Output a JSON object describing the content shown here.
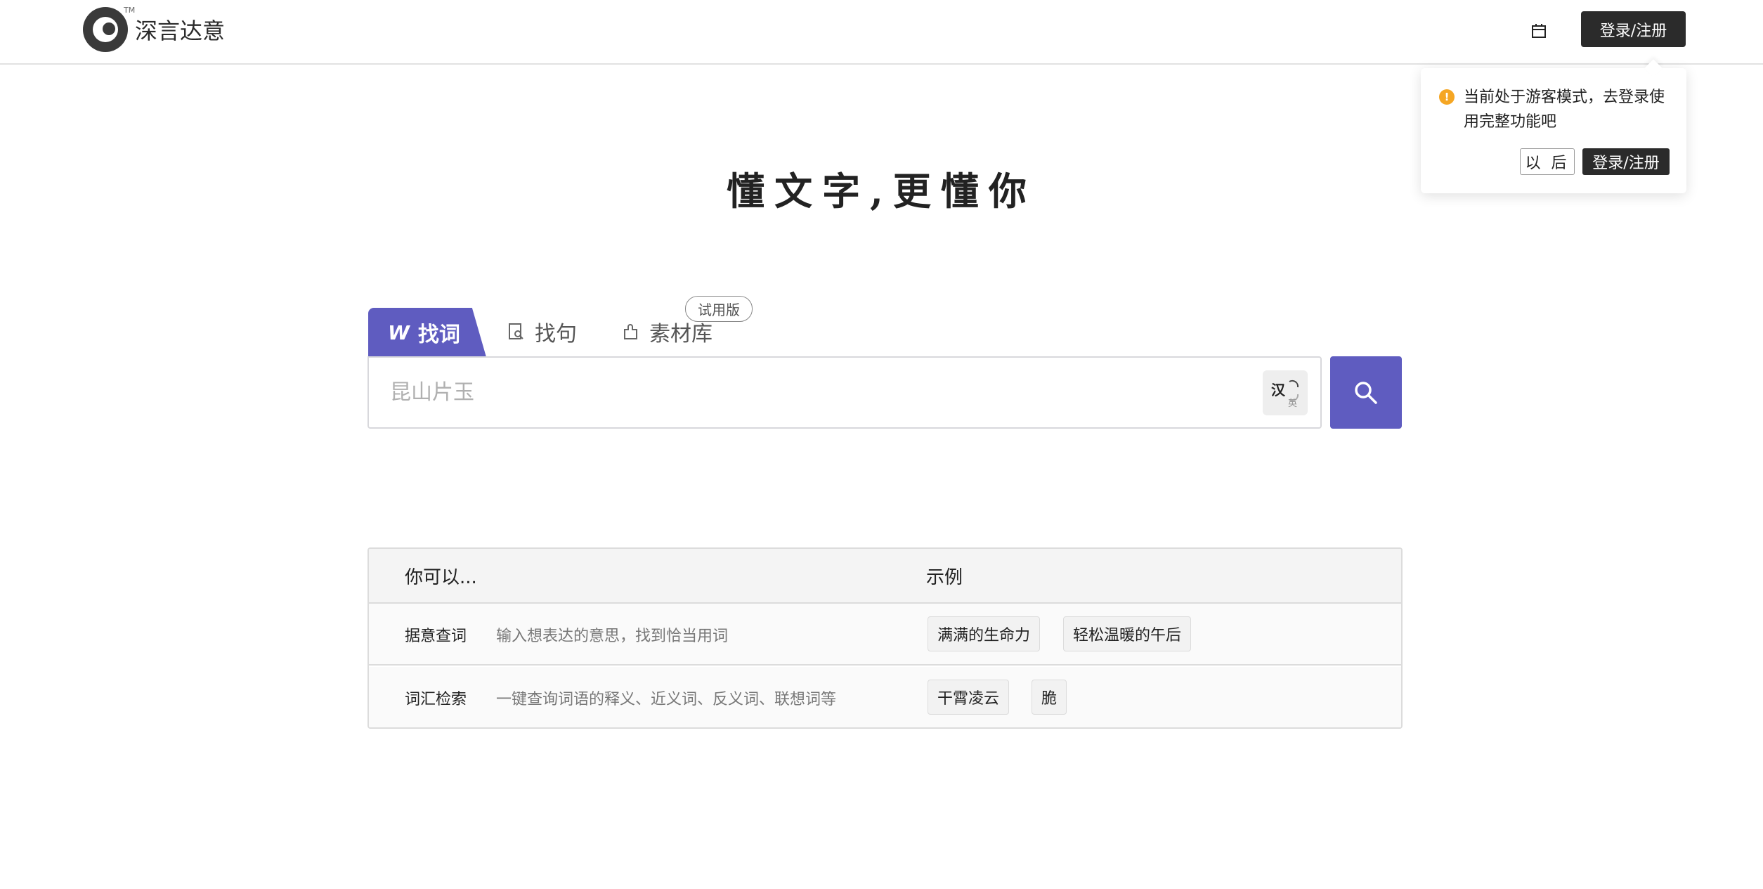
{
  "header": {
    "brand": "深言达意",
    "trademark": "TM",
    "login_label": "登录/注册",
    "icons": {
      "logo": "whale-logo",
      "calendar": "calendar-icon"
    }
  },
  "popover": {
    "message": "当前处于游客模式，去登录使用完整功能吧",
    "later_label": "以 后",
    "login_label": "登录/注册",
    "warn_glyph": "!",
    "colors": {
      "warn": "#f5a623"
    }
  },
  "hero": {
    "title": "懂文字,更懂你"
  },
  "tabs": [
    {
      "label": "找词",
      "icon": "word-icon",
      "glyph": "W",
      "active": true
    },
    {
      "label": "找句",
      "icon": "sentence-search-icon",
      "active": false
    },
    {
      "label": "素材库",
      "icon": "puzzle-icon",
      "active": false,
      "badge": "试用版"
    }
  ],
  "search": {
    "placeholder": "昆山片玉",
    "lang_primary": "汉",
    "lang_secondary": "英",
    "icons": {
      "toggle": "language-toggle-icon",
      "submit": "search-icon"
    }
  },
  "guide": {
    "headers": [
      "你可以...",
      "示例"
    ],
    "rows": [
      {
        "name": "据意查词",
        "desc": "输入想表达的意思，找到恰当用词",
        "examples": [
          "满满的生命力",
          "轻松温暖的午后"
        ]
      },
      {
        "name": "词汇检索",
        "desc": "一键查询词语的释义、近义词、反义词、联想词等",
        "examples": [
          "干霄凌云",
          "脆"
        ]
      }
    ]
  },
  "colors": {
    "accent": "#5f5cc0",
    "dark_button": "#2b2b2b"
  }
}
